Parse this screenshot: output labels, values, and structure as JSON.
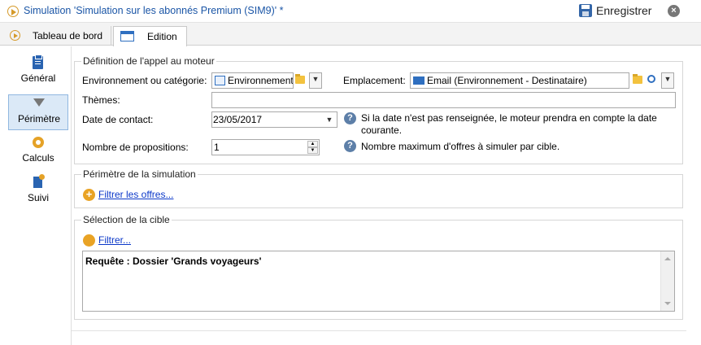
{
  "window": {
    "title": "Simulation 'Simulation sur les abonnés Premium (SIM9)' *",
    "save_label": "Enregistrer",
    "close_glyph": "×"
  },
  "tabs": [
    {
      "label": "Tableau de bord",
      "icon": "play-icon"
    },
    {
      "label": "Edition",
      "icon": "form-icon",
      "active": true
    }
  ],
  "sidebar": {
    "items": [
      {
        "label": "Général",
        "icon": "clipboard-icon"
      },
      {
        "label": "Périmètre",
        "icon": "funnel-icon",
        "active": true
      },
      {
        "label": "Calculs",
        "icon": "gear-icon"
      },
      {
        "label": "Suivi",
        "icon": "tracking-icon"
      }
    ]
  },
  "engine": {
    "legend": "Définition de l'appel au moteur",
    "env_label": "Environnement ou catégorie:",
    "env_value": "Environnement",
    "location_label": "Emplacement:",
    "location_value": "Email (Environnement - Destinataire)",
    "themes_label": "Thèmes:",
    "themes_value": "",
    "date_label": "Date de contact:",
    "date_value": "23/05/2017",
    "date_help": "Si la date n'est pas renseignée, le moteur prendra en compte la date courante.",
    "count_label": "Nombre de propositions:",
    "count_value": "1",
    "count_help": "Nombre maximum d'offres à simuler par cible."
  },
  "scope": {
    "legend": "Périmètre de la simulation",
    "filter_offers_link": "Filtrer les offres..."
  },
  "target": {
    "legend": "Sélection de la cible",
    "filter_link": "Filtrer...",
    "query_text": "Requête : Dossier 'Grands voyageurs'"
  },
  "colors": {
    "title_blue": "#1a55a6",
    "link_blue": "#0b38c9",
    "accent_orange": "#e9a325",
    "active_side_bg": "#dbe9f7"
  }
}
